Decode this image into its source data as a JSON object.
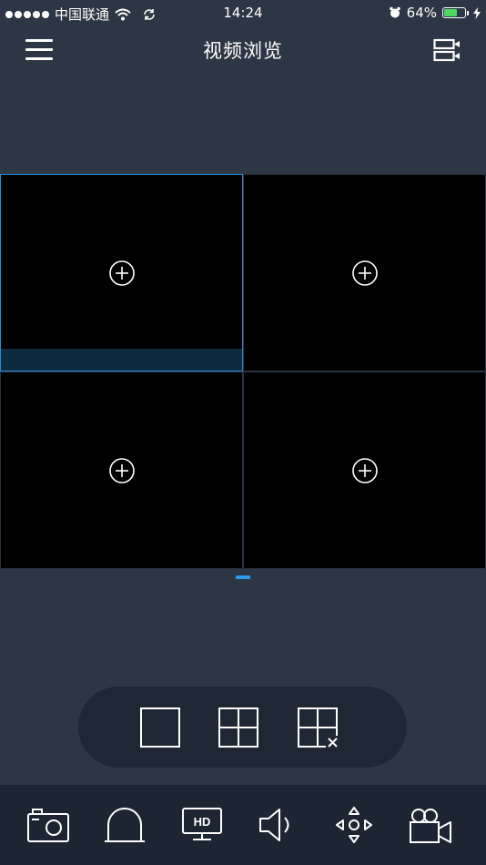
{
  "status_bar": {
    "carrier": "中国联通",
    "time": "14:24",
    "battery_percent": "64%",
    "battery_level": 0.64
  },
  "nav": {
    "title": "视频浏览"
  },
  "video_grid": {
    "cells": [
      {
        "selected": true
      },
      {
        "selected": false
      },
      {
        "selected": false
      },
      {
        "selected": false
      }
    ]
  },
  "layout_options": [
    "single-view-icon",
    "quad-view-icon",
    "close-view-icon"
  ],
  "toolbar": [
    "camera-snapshot-icon",
    "alarm-light-icon",
    "hd-icon",
    "speaker-icon",
    "ptz-direction-icon",
    "video-record-icon"
  ],
  "colors": {
    "background": "#2d3644",
    "accent": "#2b8fd8",
    "battery": "#4cd964"
  }
}
